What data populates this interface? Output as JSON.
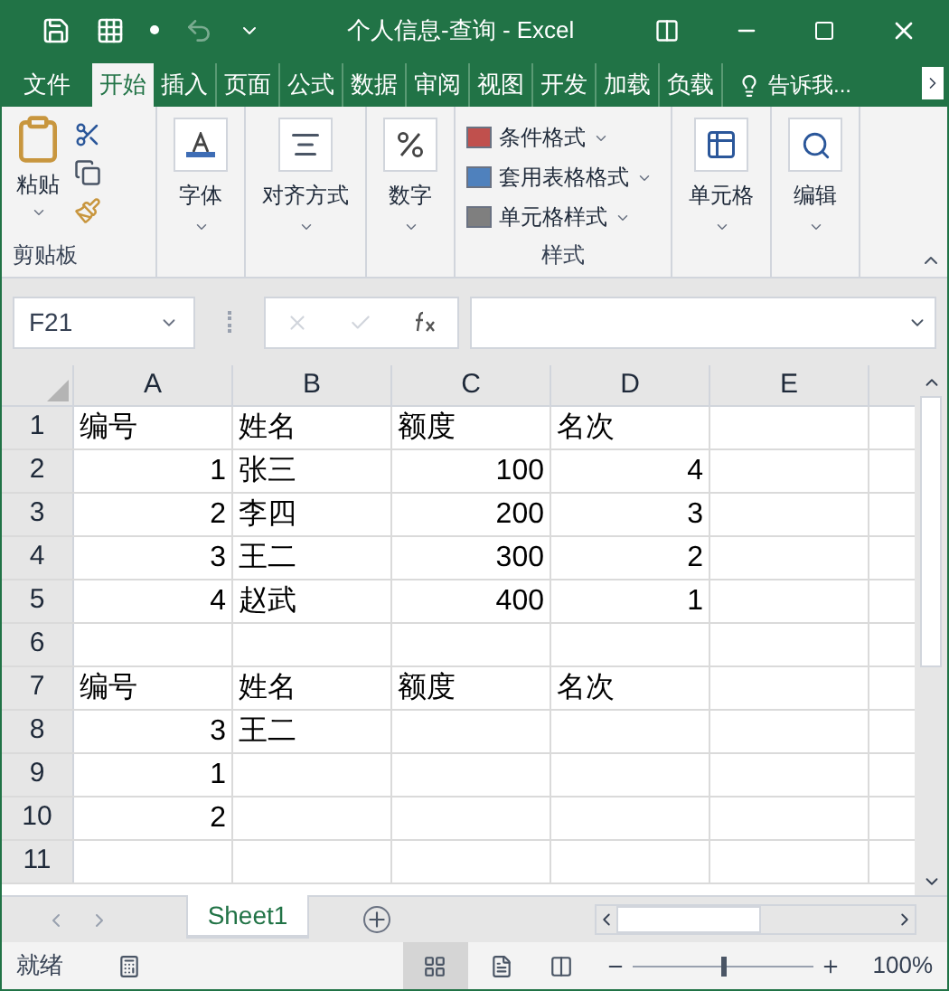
{
  "window": {
    "title": "个人信息-查询 - Excel"
  },
  "ribbon_tabs": [
    {
      "label": "文件",
      "selected": false
    },
    {
      "label": "开始",
      "selected": true
    },
    {
      "label": "插入",
      "selected": false
    },
    {
      "label": "页面",
      "selected": false
    },
    {
      "label": "公式",
      "selected": false
    },
    {
      "label": "数据",
      "selected": false
    },
    {
      "label": "审阅",
      "selected": false
    },
    {
      "label": "视图",
      "selected": false
    },
    {
      "label": "开发",
      "selected": false
    },
    {
      "label": "加载",
      "selected": false
    },
    {
      "label": "负载",
      "selected": false
    }
  ],
  "tell_me": "告诉我...",
  "clipboard": {
    "paste": "粘贴",
    "label": "剪贴板"
  },
  "big_buttons": [
    {
      "kind": "font",
      "label": "字体"
    },
    {
      "kind": "align",
      "label": "对齐方式"
    },
    {
      "kind": "number",
      "label": "数字"
    }
  ],
  "styles": {
    "items": [
      {
        "kind": "conditional",
        "label": "条件格式"
      },
      {
        "kind": "table",
        "label": "套用表格格式"
      },
      {
        "kind": "cell",
        "label": "单元格样式"
      }
    ],
    "label": "样式"
  },
  "end_buttons": [
    {
      "kind": "cells",
      "label": "单元格"
    },
    {
      "kind": "edit",
      "label": "编辑"
    }
  ],
  "name_box": "F21",
  "columns": [
    "A",
    "B",
    "C",
    "D",
    "E"
  ],
  "rows": [
    {
      "header": "1",
      "cells": [
        {
          "text": "编号",
          "kind": "text"
        },
        {
          "text": "姓名",
          "kind": "text"
        },
        {
          "text": "额度",
          "kind": "text"
        },
        {
          "text": "名次",
          "kind": "text"
        },
        null
      ]
    },
    {
      "header": "2",
      "cells": [
        {
          "text": "1",
          "kind": "number"
        },
        {
          "text": "张三",
          "kind": "text"
        },
        {
          "text": "100",
          "kind": "number"
        },
        {
          "text": "4",
          "kind": "number"
        },
        null
      ]
    },
    {
      "header": "3",
      "cells": [
        {
          "text": "2",
          "kind": "number"
        },
        {
          "text": "李四",
          "kind": "text"
        },
        {
          "text": "200",
          "kind": "number"
        },
        {
          "text": "3",
          "kind": "number"
        },
        null
      ]
    },
    {
      "header": "4",
      "cells": [
        {
          "text": "3",
          "kind": "number"
        },
        {
          "text": "王二",
          "kind": "text"
        },
        {
          "text": "300",
          "kind": "number"
        },
        {
          "text": "2",
          "kind": "number"
        },
        null
      ]
    },
    {
      "header": "5",
      "cells": [
        {
          "text": "4",
          "kind": "number"
        },
        {
          "text": "赵武",
          "kind": "text"
        },
        {
          "text": "400",
          "kind": "number"
        },
        {
          "text": "1",
          "kind": "number"
        },
        null
      ]
    },
    {
      "header": "6",
      "cells": [
        null,
        null,
        null,
        null,
        null
      ]
    },
    {
      "header": "7",
      "cells": [
        {
          "text": "编号",
          "kind": "text"
        },
        {
          "text": "姓名",
          "kind": "text"
        },
        {
          "text": "额度",
          "kind": "text"
        },
        {
          "text": "名次",
          "kind": "text"
        },
        null
      ]
    },
    {
      "header": "8",
      "cells": [
        {
          "text": "3",
          "kind": "number"
        },
        {
          "text": "王二",
          "kind": "text"
        },
        null,
        null,
        null
      ]
    },
    {
      "header": "9",
      "cells": [
        {
          "text": "1",
          "kind": "number"
        },
        null,
        null,
        null,
        null
      ]
    },
    {
      "header": "10",
      "cells": [
        {
          "text": "2",
          "kind": "number"
        },
        null,
        null,
        null,
        null
      ]
    },
    {
      "header": "11",
      "cells": [
        null,
        null,
        null,
        null,
        null
      ]
    }
  ],
  "sheet_tabs": [
    {
      "label": "Sheet1",
      "selected": true
    }
  ],
  "status_bar": {
    "text": "就绪",
    "zoom": {
      "level": 0.5,
      "reading": "100%"
    }
  }
}
